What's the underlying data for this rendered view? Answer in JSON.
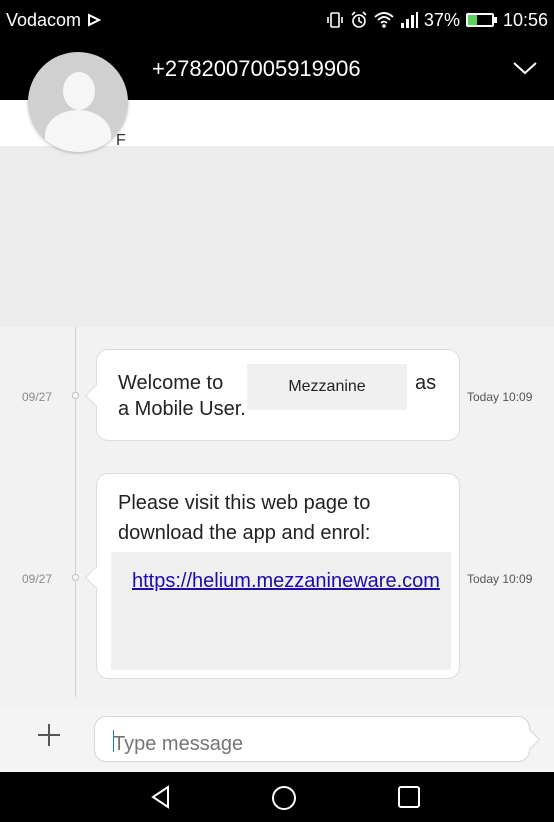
{
  "status_bar": {
    "carrier": "Vodacom",
    "battery_text": "37%",
    "battery_level": 0.37,
    "time": "10:56",
    "icons": [
      "notification-icon",
      "vibrate-icon",
      "alarm-icon",
      "wifi-icon",
      "signal-icon",
      "battery-icon"
    ]
  },
  "header": {
    "contact_number": "+2782007005919906",
    "expand_icon": "chevron-down-icon"
  },
  "preview": {
    "text": "F"
  },
  "messages": [
    {
      "date": "09/27",
      "time": "Today 10:09",
      "line1_start": "Welcome to",
      "redaction_label": "Mezzanine",
      "line1_end": "as",
      "line2": "a Mobile User."
    },
    {
      "date": "09/27",
      "time": "Today 10:09",
      "line1": "Please visit this web page to",
      "line2": "download the app and enrol:",
      "link": "https://helium.mezzanineware.com"
    }
  ],
  "composer": {
    "add_icon": "plus-icon",
    "placeholder": "Type message"
  },
  "nav_bar": {
    "icons": [
      "back-icon",
      "home-icon",
      "recents-icon"
    ]
  },
  "colors": {
    "link": "#1a0dab",
    "header_bg": "#000000",
    "battery_fill": "#5cd25c"
  }
}
